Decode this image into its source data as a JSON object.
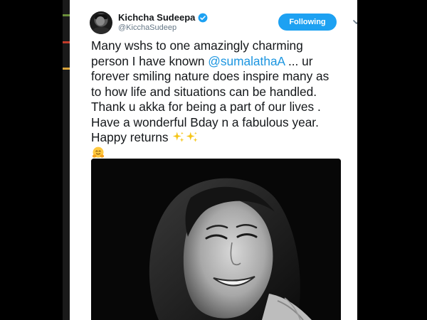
{
  "tweet": {
    "author_name": "Kichcha Sudeepa",
    "author_handle": "@KicchaSudeep",
    "follow_label": "Following",
    "text_lines": {
      "l1": "Many wshs to one amazingly charming",
      "l2_before": "person I have known ",
      "l2_mention": "@sumalathaA",
      "l2_after": " ... ur",
      "l3": "forever smiling nature does inspire many as",
      "l4": "to how life and situations can be handled.",
      "l5": "Thank u akka for being a part of our lives .",
      "l6": "Have a wonderful Bday n a fabulous year.",
      "l7": "Happy returns "
    },
    "emoji": [
      "sparkles-icon",
      "sparkles-icon",
      "hugging-face-icon"
    ]
  },
  "colors": {
    "accent": "#1da1f2",
    "mention": "#1b95e0",
    "text": "#14171a",
    "muted": "#657786"
  }
}
